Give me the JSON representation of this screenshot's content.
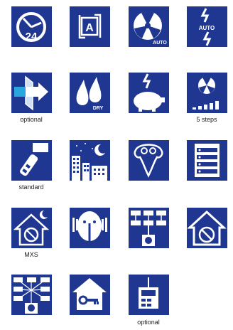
{
  "colors": {
    "tile": "#1f3790",
    "icon": "#ffffff"
  },
  "icons": [
    {
      "name": "timer-24h-icon",
      "text": "24"
    },
    {
      "name": "auto-mode-icon",
      "text": "A"
    },
    {
      "name": "auto-fan-icon",
      "text": "AUTO"
    },
    {
      "name": "auto-power-icon",
      "text": "AUTO"
    },
    {
      "name": "airflow-through-wall-icon",
      "caption": "optional"
    },
    {
      "name": "dry-mode-icon",
      "text": "DRY"
    },
    {
      "name": "econo-piggy-bank-icon"
    },
    {
      "name": "fan-speed-steps-icon",
      "caption": "5 steps"
    },
    {
      "name": "remote-control-icon",
      "caption": "standard"
    },
    {
      "name": "night-mode-city-icon"
    },
    {
      "name": "comfort-people-icon"
    },
    {
      "name": "menu-list-icon"
    },
    {
      "name": "home-away-night-icon",
      "caption": "MXS"
    },
    {
      "name": "quiet-person-icon"
    },
    {
      "name": "multi-unit-network-icon"
    },
    {
      "name": "home-fan-icon"
    },
    {
      "name": "central-control-network-icon"
    },
    {
      "name": "home-key-icon"
    },
    {
      "name": "wired-controller-icon",
      "caption": "optional"
    }
  ]
}
